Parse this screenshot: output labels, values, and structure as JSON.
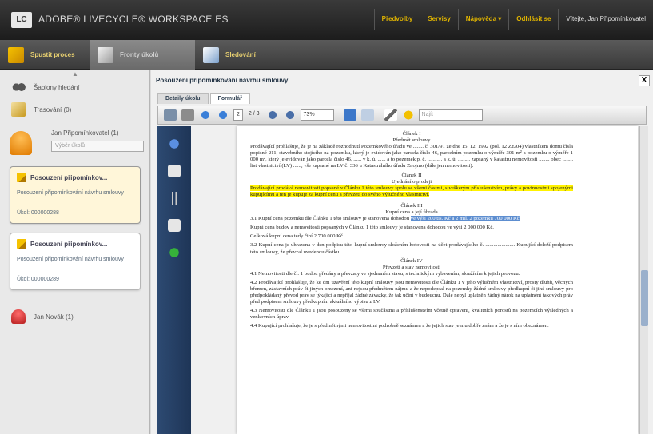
{
  "app": {
    "logo": "LC",
    "title": "ADOBE® LIVECYCLE® WORKSPACE ES"
  },
  "topnav": {
    "items": [
      "Předvolby",
      "Servisy",
      "Nápověda ▾",
      "Odhlásit se"
    ],
    "user": "Vítejte, Jan Připomínkovatel"
  },
  "toolbar": {
    "tabs": [
      "Spustit proces",
      "Fronty úkolů",
      "Sledování"
    ]
  },
  "sidebar": {
    "up": "▲",
    "items": [
      {
        "label": "Šablony hledání",
        "icon": "binoculars-icon"
      },
      {
        "label": "Trasování (0)",
        "icon": "checklist-icon"
      }
    ],
    "user": {
      "name": "Jan Připomínkovatel (1)",
      "select": "Výběr úkolů"
    },
    "cards": [
      {
        "title": "Posouzení připomínkov...",
        "desc": "Posouzení připomínkování návrhu smlouvy",
        "id": "Úkol: 000000288"
      },
      {
        "title": "Posouzení připomínkov...",
        "desc": "Posouzení připomínkování návrhu smlouvy",
        "id": "Úkol: 000000289"
      }
    ],
    "other_user": "Jan Novák (1)"
  },
  "content": {
    "title": "Posouzení připomínkování návrhu smlouvy",
    "close": "X",
    "tabs": [
      "Detaily úkolu",
      "Formulář"
    ],
    "pdf": {
      "page": "2",
      "pages": "2 / 3",
      "zoom": "73%",
      "search": "Najít"
    }
  },
  "document": {
    "h1": "Článek I",
    "h1b": "Předmět smlouvy",
    "p1": "Prodávající prohlašuje, že je na základě rozhodnutí Pozemkového úřadu ve ........ č. 301/91 ze dne 15. 12. 1992 (pol. 12 ZE/04) vlastníkem domu čísla popisné 211, stavebního stojícího na pozemku, který je evidován jako parcela číslo 46, parcelním pozemku o výměře 301 m² a pozemku o výměře 1 000 m², který je evidován jako parcela číslo 46, ...... v k. ú. ...... a to pozemek p. č. ........... a k. ú. ......... zapsaný v katastru nemovitostí ........ obec ........ list vlastnictví (LV) ......, vše zapsané na LV č. 336 u Katastrálního úřadu Znojmo (dále jen nemovitosti).",
    "h2": "Článek II",
    "h2b": "Ujednání o prodeji",
    "p2": "Prodávající prodává nemovitosti popsané v Článku 1 této smlouvy spolu se všemi částmi, s veškerým příslušenstvím, právy a povinnostmi spojenými kupujícímu a ten je kupuje za kupní cenu a převzetí do svého výlučného vlastnictví.",
    "h3": "Článek III",
    "h3b": "Kupní cena a její úhrada",
    "p3a": "3.1 Kupní cena pozemku dle Článku 1 této smlouvy je stanovena dohodou ",
    "p3sel": "ve výši 200 tis. Kč a 2 mil. 2 pozemku 700 000 Kč",
    "p3b": "Kupní cena budov a nemovitostí popsaných v Článku 1 této smlouvy je stanovena dohodou ve výši 2 000 000 Kč.",
    "p3c": "Celková kupní cena tedy činí 2 700 000 Kč.",
    "p3d": "3.2 Kupní cena je uhrazena v den podpisu této kupní smlouvy složením hotovosti na účet prodávajícího č. ...................... Kupující doloží podpisem této smlouvy, že převzal uvedenou částku.",
    "h4": "Článek IV",
    "h4b": "Převzetí a stav nemovitostí",
    "p4a": "4.1 Nemovitosti dle čl. 1 budou předány a převzaty ve sjednaném stavu, s technickým vybavením, sloužícím k jejich provozu.",
    "p4b": "4.2 Prodávající prohlašuje, že ke dni uzavření této kupní smlouvy jsou nemovitosti dle Článku 1 v jeho výlučném vlastnictví, prosty dluhů, věcných břemen, zástavních práv či jiných omezení, ani nejsou předmětem nájmu a že nepodepsal na pozemky žádné smlouvy předkupní či jiné smlouvy pro předpokládaný převod práv se týkající a nepřijal žádné závazky, že tak učiní v budoucnu. Dále nebyl uplatněn žádný nárok na uplatnění takových práv před podpisem smlouvy předkupním aktuálního výpisu z LV.",
    "p4c": "4.3 Nemovitosti dle Článku 1 jsou posouzeny se všemi součástmi a příslušenstvím včetně opravení, kvalitních porostů na pozemcích výsledných a venkovních úprav.",
    "p4d": "4.4 Kupující prohlašuje, že je s předmětnými nemovitostmi podrobně seznámen a že jejich stav je mu dobře znám a že je s ním obeznámen."
  },
  "colors": {
    "accent": "#e0b400",
    "highlight": "#fff200",
    "selection": "#5d8ed0",
    "rail": "#1e3557"
  }
}
